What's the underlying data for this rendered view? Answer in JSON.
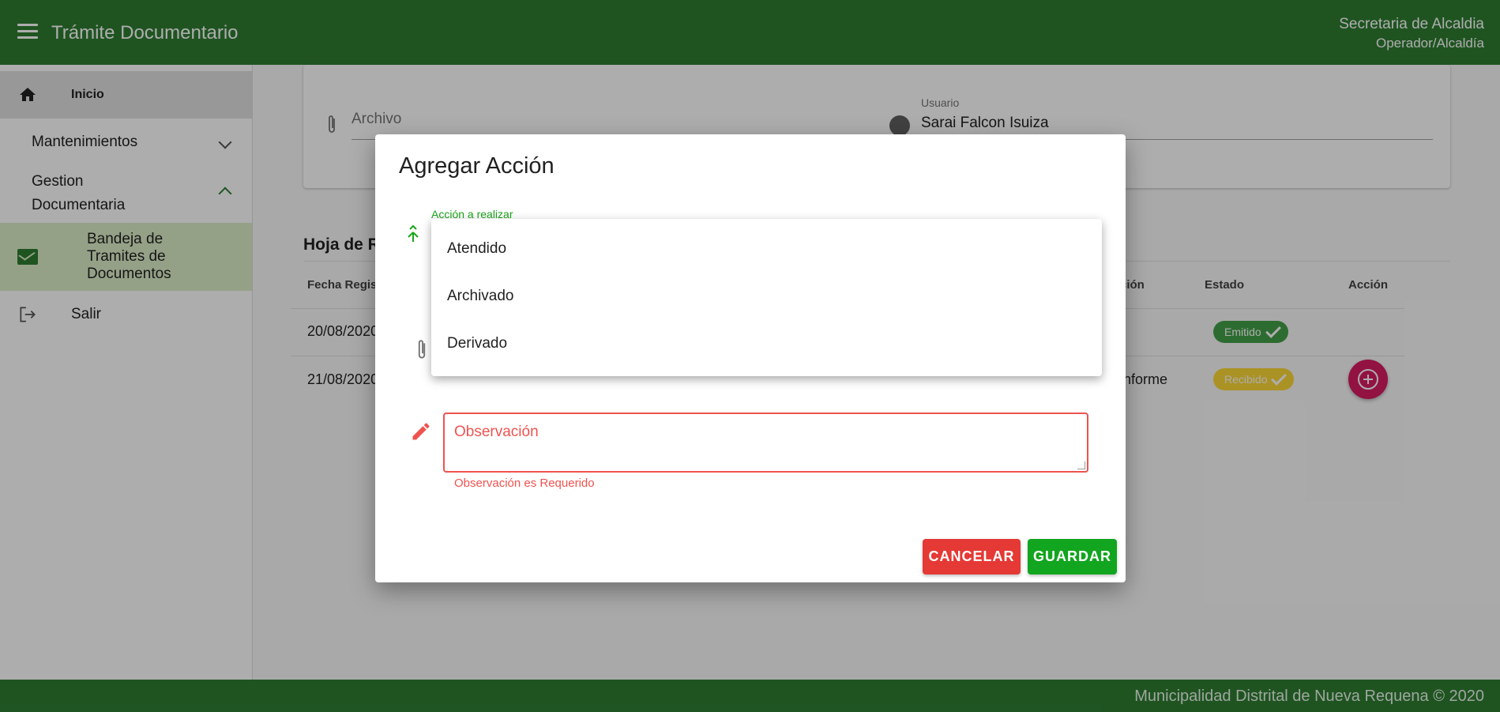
{
  "header": {
    "title": "Trámite Documentario",
    "user_name": "Secretaria de Alcaldia",
    "user_role": "Operador/Alcaldía"
  },
  "sidebar": {
    "items": [
      {
        "label": "Inicio",
        "icon": "home-icon"
      },
      {
        "label": "Mantenimientos"
      },
      {
        "label": "Gestion Documentaria"
      },
      {
        "label": "Bandeja de Tramites de Documentos",
        "icon": "mail-icon"
      },
      {
        "label": "Salir",
        "icon": "exit-icon"
      }
    ]
  },
  "main": {
    "archivo_placeholder": "Archivo",
    "usuario_label": "Usuario",
    "usuario_value": "Sarai Falcon Isuiza",
    "section_title": "Hoja de R",
    "columns": [
      "Fecha Regist",
      "ción",
      "Estado",
      "Acción"
    ],
    "rows": [
      {
        "fecha": "20/08/2020",
        "detalle": "",
        "estado": "Emitido"
      },
      {
        "fecha": "21/08/2020",
        "detalle": "onforme",
        "estado": "Recibido"
      }
    ]
  },
  "dialog": {
    "title": "Agregar Acción",
    "accion_label": "Acción a realizar",
    "options": [
      "Atendido",
      "Archivado",
      "Derivado"
    ],
    "observacion_placeholder": "Observación",
    "observacion_error": "Observación es Requerido",
    "cancel_label": "CANCELAR",
    "save_label": "GUARDAR"
  },
  "footer": {
    "text": "Municipalidad Distrital de Nueva Requena © 2020"
  },
  "colors": {
    "primary": "#2e7d32",
    "accent_green": "#12a51f",
    "danger": "#e53935",
    "fab": "#d81b60"
  }
}
